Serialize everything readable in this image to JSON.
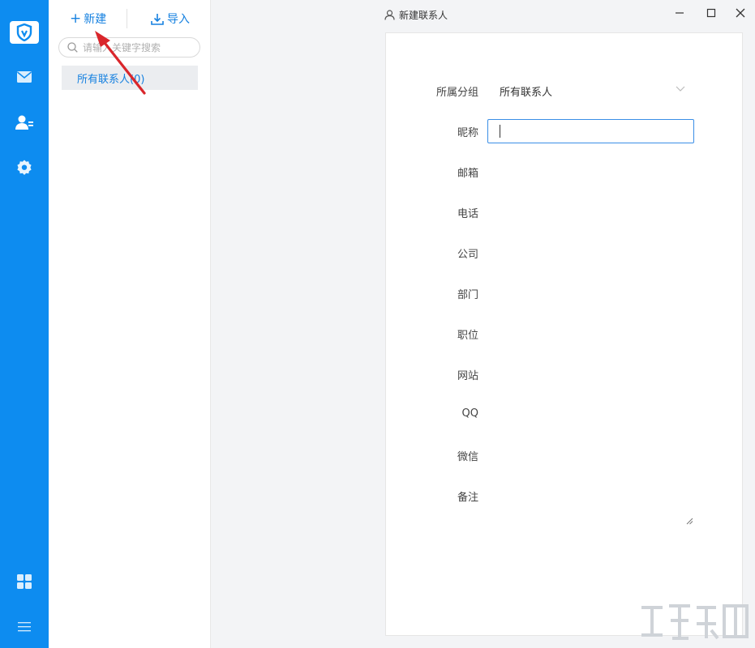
{
  "toolbar": {
    "new_label": "新建",
    "import_label": "导入"
  },
  "search": {
    "placeholder": "请输入关键字搜索"
  },
  "groups": [
    {
      "label": "所有联系人(0)"
    }
  ],
  "window": {
    "title": "新建联系人"
  },
  "form": {
    "group_label": "所属分组",
    "group_value": "所有联系人",
    "fields": [
      {
        "label": "昵称"
      },
      {
        "label": "邮箱"
      },
      {
        "label": "电话"
      },
      {
        "label": "公司"
      },
      {
        "label": "部门"
      },
      {
        "label": "职位"
      },
      {
        "label": "网站"
      },
      {
        "label": "QQ"
      },
      {
        "label": "微信"
      },
      {
        "label": "备注"
      }
    ]
  },
  "colors": {
    "rail": "#0d8cf0",
    "accent": "#1681e0",
    "arrow": "#d9262b"
  },
  "icons": [
    "app-logo-icon",
    "mail-icon",
    "contacts-icon",
    "settings-icon",
    "apps-grid-icon",
    "menu-icon",
    "search-icon",
    "plus-icon",
    "download-icon",
    "user-icon",
    "minimize-icon",
    "maximize-icon",
    "close-icon",
    "chevron-down-icon",
    "resize-handle-icon"
  ]
}
